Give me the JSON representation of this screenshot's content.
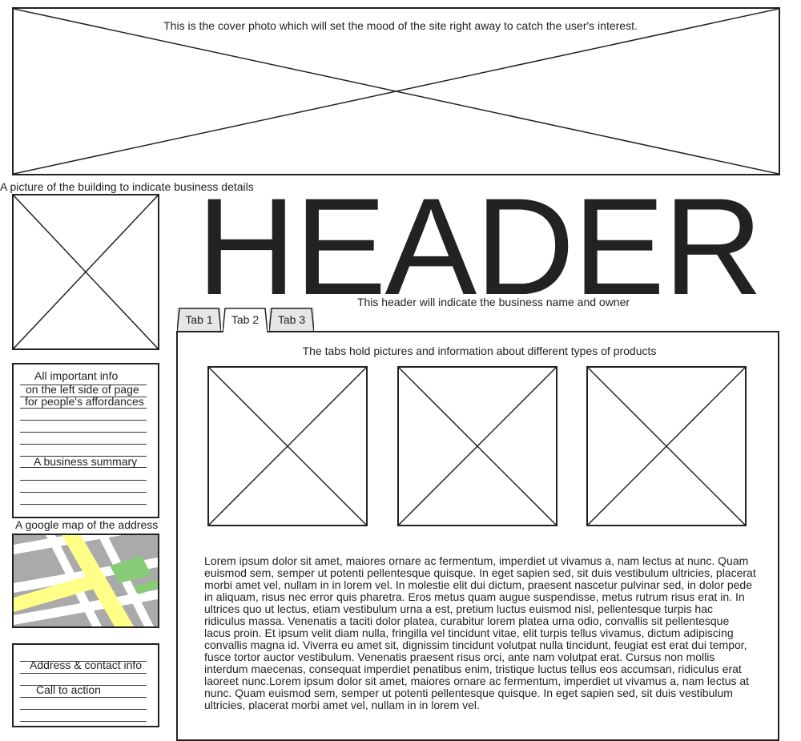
{
  "cover": {
    "caption": "This is the cover photo which will set the mood of the site right away to catch the user's interest."
  },
  "building": {
    "caption": "A picture of the building to indicate business details"
  },
  "header": {
    "title": "HEADER",
    "subtitle": "This header will indicate the business name and owner"
  },
  "tabs": [
    {
      "label": "Tab 1"
    },
    {
      "label": "Tab 2"
    },
    {
      "label": "Tab 3"
    }
  ],
  "active_tab": "Tab 2",
  "tab_panel": {
    "caption": "The tabs hold pictures and information about different types of products",
    "body": "Lorem ipsum dolor sit amet, maiores ornare ac fermentum, imperdiet ut vivamus a, nam lectus at nunc. Quam euismod sem, semper ut potenti pellentesque quisque. In eget sapien sed, sit duis vestibulum ultricies, placerat morbi amet vel, nullam in in lorem vel. In molestie elit dui dictum, praesent nascetur pulvinar sed, in dolor pede in aliquam, risus nec error quis pharetra. Eros metus quam augue suspendisse, metus rutrum risus erat in.  In ultrices quo ut lectus, etiam vestibulum urna a est, pretium luctus euismod nisl, pellentesque turpis hac ridiculus massa. Venenatis a taciti dolor platea, curabitur lorem platea urna odio, convallis sit pellentesque lacus proin. Et ipsum velit diam nulla, fringilla vel tincidunt vitae, elit turpis tellus vivamus, dictum adipiscing convallis magna id. Viverra eu amet sit, dignissim tincidunt volutpat nulla tincidunt, feugiat est erat dui tempor, fusce tortor auctor vestibulum. Venenatis praesent risus orci, ante nam volutpat erat. Cursus non mollis interdum maecenas, consequat imperdiet penatibus enim, tristique luctus tellus eos accumsan, ridiculus erat laoreet nunc.Lorem ipsum dolor sit amet, maiores ornare ac fermentum, imperdiet ut vivamus a, nam lectus at nunc. Quam euismod sem, semper ut potenti pellentesque quisque. In eget sapien sed, sit duis vestibulum ultricies, placerat morbi amet vel, nullam in in lorem vel."
  },
  "info_box": {
    "line1": "All important info",
    "line2": "on the left side of page",
    "line3": "for people's affordances",
    "summary": "A business summary"
  },
  "map": {
    "caption": "A google map of the address",
    "colors": {
      "road_major": "#ffff88",
      "road_minor": "#ffffff",
      "block": "#aaaaaa",
      "park": "#88cc77"
    }
  },
  "contact_box": {
    "address": "Address & contact info",
    "cta": "Call to action"
  },
  "icons": {
    "image_placeholder": "x-crossed-rectangle",
    "map": "map-tile"
  }
}
